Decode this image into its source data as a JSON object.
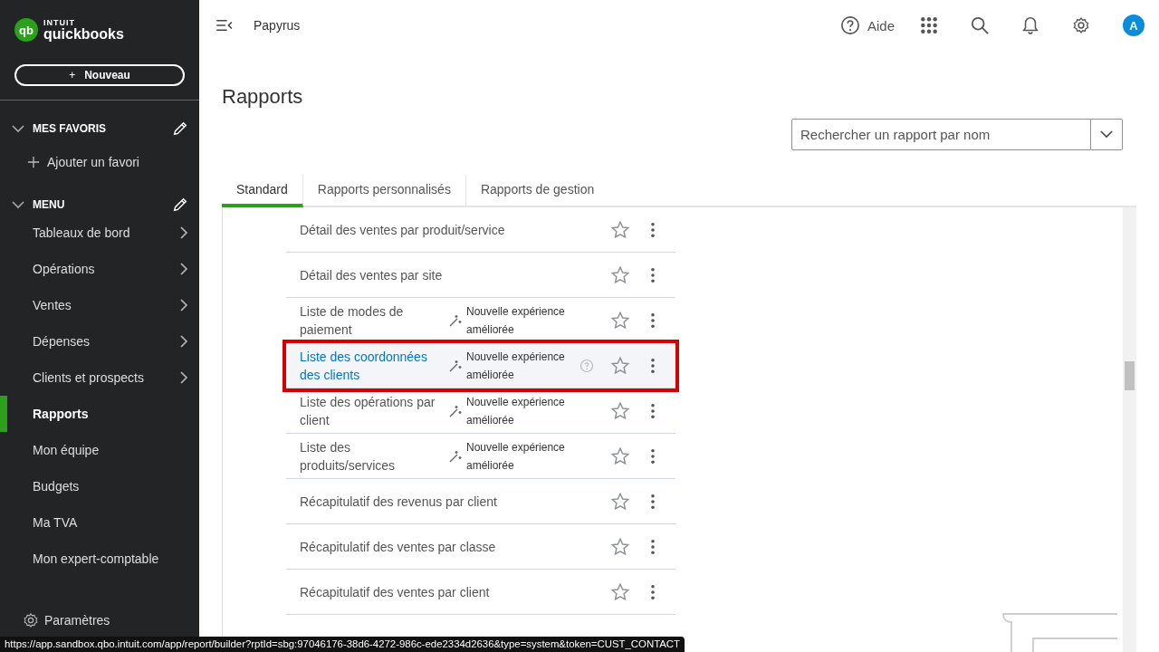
{
  "logo": {
    "mark": "qb",
    "top": "INTUIT",
    "name": "quickbooks"
  },
  "new_button": {
    "icon": "+",
    "label": "Nouveau"
  },
  "favorites": {
    "title": "MES FAVORIS",
    "expanded": true,
    "add": "Ajouter un favori"
  },
  "menu": {
    "title": "MENU",
    "expanded": true,
    "items": [
      {
        "label": "Tableaux de bord",
        "expandable": true,
        "selected": false
      },
      {
        "label": "Opérations",
        "expandable": true,
        "selected": false
      },
      {
        "label": "Ventes",
        "expandable": true,
        "selected": false
      },
      {
        "label": "Dépenses",
        "expandable": true,
        "selected": false
      },
      {
        "label": "Clients et prospects",
        "expandable": true,
        "selected": false
      },
      {
        "label": "Rapports",
        "expandable": false,
        "selected": true
      },
      {
        "label": "Mon équipe",
        "expandable": false,
        "selected": false
      },
      {
        "label": "Budgets",
        "expandable": false,
        "selected": false
      },
      {
        "label": "Ma TVA",
        "expandable": false,
        "selected": false
      },
      {
        "label": "Mon expert-comptable",
        "expandable": false,
        "selected": false
      }
    ]
  },
  "settings": "Paramètres",
  "header": {
    "company": "Papyrus",
    "help": "Aide",
    "avatar": "A"
  },
  "page_title": "Rapports",
  "search": {
    "placeholder": "Rechercher un rapport par nom"
  },
  "tabs": [
    {
      "label": "Standard",
      "selected": true
    },
    {
      "label": "Rapports personnalisés",
      "selected": false
    },
    {
      "label": "Rapports de gestion",
      "selected": false
    }
  ],
  "reports": [
    {
      "name": "Détail des ventes par produit/service",
      "selected": false
    },
    {
      "name": "Détail des ventes par site",
      "selected": false
    },
    {
      "name": "Liste de modes de paiement",
      "badge": "Nouvelle expérience améliorée",
      "selected": false
    },
    {
      "name": "Liste des coordonnées des clients",
      "badge": "Nouvelle expérience améliorée",
      "selected": true
    },
    {
      "name": "Liste des opérations par client",
      "badge": "Nouvelle expérience améliorée",
      "selected": false
    },
    {
      "name": "Liste des produits/services",
      "badge": "Nouvelle expérience améliorée",
      "selected": false
    },
    {
      "name": "Récapitulatif des revenus par client",
      "selected": false
    },
    {
      "name": "Récapitulatif des ventes par classe",
      "selected": false
    },
    {
      "name": "Récapitulatif des ventes par client",
      "selected": false
    }
  ],
  "status_url": "https://app.sandbox.qbo.intuit.com/app/report/builder?rptId=sbg:97046176-38d6-4272-986c-ede2334d2636&type=system&token=CUST_CONTACT"
}
